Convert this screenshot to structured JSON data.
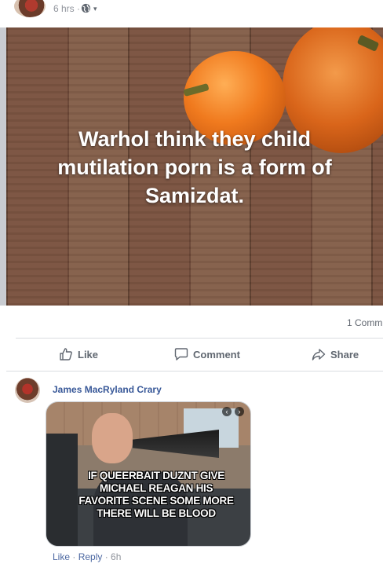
{
  "post": {
    "time": "6 hrs",
    "time_separator": "·",
    "privacy_icon": "globe-icon",
    "caret": "▾",
    "image_caption": "Warhol think they child mutilation porn is a form of Samizdat."
  },
  "stats": {
    "comments": "1 Comm"
  },
  "actions": {
    "like": "Like",
    "comment": "Comment",
    "share": "Share"
  },
  "comment": {
    "author": "James MacRyland Crary",
    "meme_text": "IF QUEERBAIT DUZNT GIVE MICHAEL REAGAN HIS FAVORITE SCENE SOME MORE THERE WILL BE BLOOD",
    "like": "Like",
    "sep1": " · ",
    "reply": "Reply",
    "sep2": " · ",
    "time": "6h"
  },
  "colors": {
    "link": "#385898",
    "meta": "#90949c",
    "action": "#606770"
  }
}
